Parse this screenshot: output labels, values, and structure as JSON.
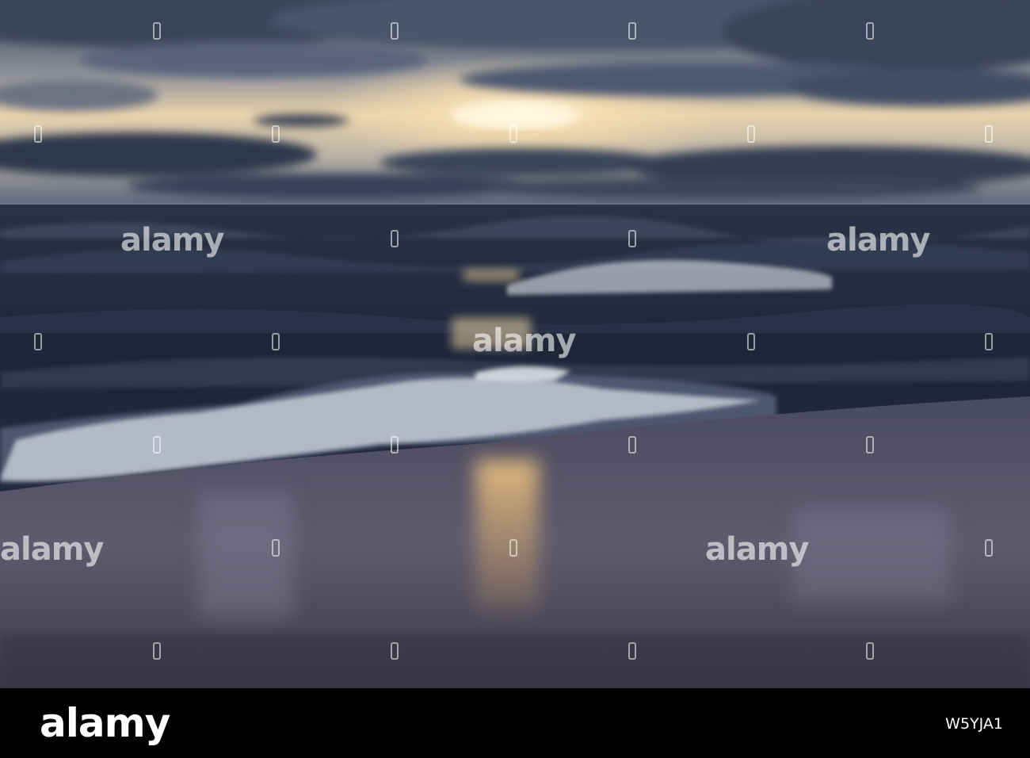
{
  "photo": {
    "subject": "sunset-over-sea-waves",
    "colors": {
      "sky_top": "#3b4456",
      "sky_glow": "#f2dcae",
      "sun": "#fff3cf",
      "cloud_dark": "#2c3447",
      "cloud_mid": "#55607a",
      "sea_dark": "#1c2234",
      "sea_mid": "#3a4358",
      "foam": "#d9dde6",
      "sand": "#5e5a6c",
      "reflection": "#e8b56c"
    }
  },
  "watermark": {
    "brand": "alamy"
  },
  "footer": {
    "logo": "alamy",
    "image_id": "W5YJA1"
  }
}
